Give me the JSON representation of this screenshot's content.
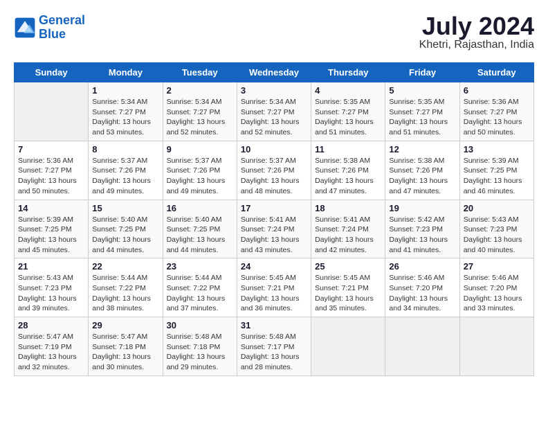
{
  "logo": {
    "line1": "General",
    "line2": "Blue"
  },
  "title": "July 2024",
  "subtitle": "Khetri, Rajasthan, India",
  "days_header": [
    "Sunday",
    "Monday",
    "Tuesday",
    "Wednesday",
    "Thursday",
    "Friday",
    "Saturday"
  ],
  "weeks": [
    [
      {
        "day": "",
        "info": ""
      },
      {
        "day": "1",
        "info": "Sunrise: 5:34 AM\nSunset: 7:27 PM\nDaylight: 13 hours\nand 53 minutes."
      },
      {
        "day": "2",
        "info": "Sunrise: 5:34 AM\nSunset: 7:27 PM\nDaylight: 13 hours\nand 52 minutes."
      },
      {
        "day": "3",
        "info": "Sunrise: 5:34 AM\nSunset: 7:27 PM\nDaylight: 13 hours\nand 52 minutes."
      },
      {
        "day": "4",
        "info": "Sunrise: 5:35 AM\nSunset: 7:27 PM\nDaylight: 13 hours\nand 51 minutes."
      },
      {
        "day": "5",
        "info": "Sunrise: 5:35 AM\nSunset: 7:27 PM\nDaylight: 13 hours\nand 51 minutes."
      },
      {
        "day": "6",
        "info": "Sunrise: 5:36 AM\nSunset: 7:27 PM\nDaylight: 13 hours\nand 50 minutes."
      }
    ],
    [
      {
        "day": "7",
        "info": "Sunrise: 5:36 AM\nSunset: 7:27 PM\nDaylight: 13 hours\nand 50 minutes."
      },
      {
        "day": "8",
        "info": "Sunrise: 5:37 AM\nSunset: 7:26 PM\nDaylight: 13 hours\nand 49 minutes."
      },
      {
        "day": "9",
        "info": "Sunrise: 5:37 AM\nSunset: 7:26 PM\nDaylight: 13 hours\nand 49 minutes."
      },
      {
        "day": "10",
        "info": "Sunrise: 5:37 AM\nSunset: 7:26 PM\nDaylight: 13 hours\nand 48 minutes."
      },
      {
        "day": "11",
        "info": "Sunrise: 5:38 AM\nSunset: 7:26 PM\nDaylight: 13 hours\nand 47 minutes."
      },
      {
        "day": "12",
        "info": "Sunrise: 5:38 AM\nSunset: 7:26 PM\nDaylight: 13 hours\nand 47 minutes."
      },
      {
        "day": "13",
        "info": "Sunrise: 5:39 AM\nSunset: 7:25 PM\nDaylight: 13 hours\nand 46 minutes."
      }
    ],
    [
      {
        "day": "14",
        "info": "Sunrise: 5:39 AM\nSunset: 7:25 PM\nDaylight: 13 hours\nand 45 minutes."
      },
      {
        "day": "15",
        "info": "Sunrise: 5:40 AM\nSunset: 7:25 PM\nDaylight: 13 hours\nand 44 minutes."
      },
      {
        "day": "16",
        "info": "Sunrise: 5:40 AM\nSunset: 7:25 PM\nDaylight: 13 hours\nand 44 minutes."
      },
      {
        "day": "17",
        "info": "Sunrise: 5:41 AM\nSunset: 7:24 PM\nDaylight: 13 hours\nand 43 minutes."
      },
      {
        "day": "18",
        "info": "Sunrise: 5:41 AM\nSunset: 7:24 PM\nDaylight: 13 hours\nand 42 minutes."
      },
      {
        "day": "19",
        "info": "Sunrise: 5:42 AM\nSunset: 7:23 PM\nDaylight: 13 hours\nand 41 minutes."
      },
      {
        "day": "20",
        "info": "Sunrise: 5:43 AM\nSunset: 7:23 PM\nDaylight: 13 hours\nand 40 minutes."
      }
    ],
    [
      {
        "day": "21",
        "info": "Sunrise: 5:43 AM\nSunset: 7:23 PM\nDaylight: 13 hours\nand 39 minutes."
      },
      {
        "day": "22",
        "info": "Sunrise: 5:44 AM\nSunset: 7:22 PM\nDaylight: 13 hours\nand 38 minutes."
      },
      {
        "day": "23",
        "info": "Sunrise: 5:44 AM\nSunset: 7:22 PM\nDaylight: 13 hours\nand 37 minutes."
      },
      {
        "day": "24",
        "info": "Sunrise: 5:45 AM\nSunset: 7:21 PM\nDaylight: 13 hours\nand 36 minutes."
      },
      {
        "day": "25",
        "info": "Sunrise: 5:45 AM\nSunset: 7:21 PM\nDaylight: 13 hours\nand 35 minutes."
      },
      {
        "day": "26",
        "info": "Sunrise: 5:46 AM\nSunset: 7:20 PM\nDaylight: 13 hours\nand 34 minutes."
      },
      {
        "day": "27",
        "info": "Sunrise: 5:46 AM\nSunset: 7:20 PM\nDaylight: 13 hours\nand 33 minutes."
      }
    ],
    [
      {
        "day": "28",
        "info": "Sunrise: 5:47 AM\nSunset: 7:19 PM\nDaylight: 13 hours\nand 32 minutes."
      },
      {
        "day": "29",
        "info": "Sunrise: 5:47 AM\nSunset: 7:18 PM\nDaylight: 13 hours\nand 30 minutes."
      },
      {
        "day": "30",
        "info": "Sunrise: 5:48 AM\nSunset: 7:18 PM\nDaylight: 13 hours\nand 29 minutes."
      },
      {
        "day": "31",
        "info": "Sunrise: 5:48 AM\nSunset: 7:17 PM\nDaylight: 13 hours\nand 28 minutes."
      },
      {
        "day": "",
        "info": ""
      },
      {
        "day": "",
        "info": ""
      },
      {
        "day": "",
        "info": ""
      }
    ]
  ]
}
